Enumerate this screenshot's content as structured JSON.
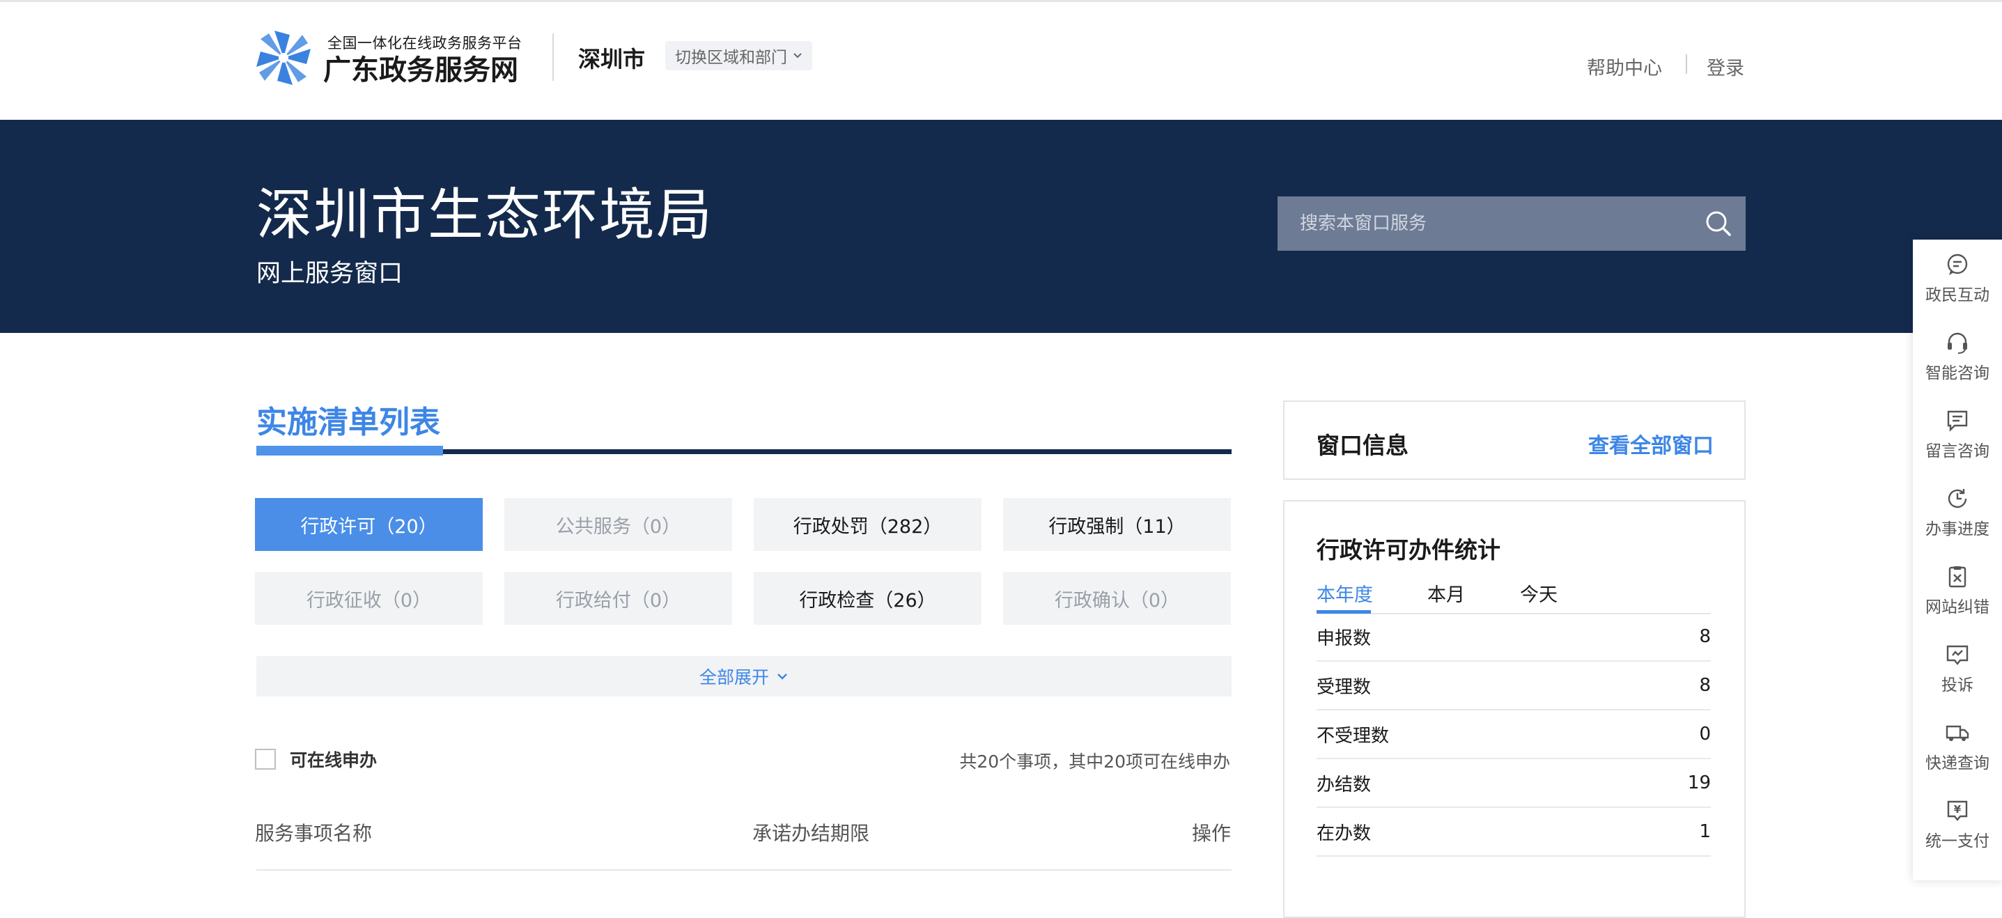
{
  "header": {
    "logo_top": "全国一体化在线政务服务平台",
    "logo_main": "广东政务服务网",
    "city": "深圳市",
    "region_switch": "切换区域和部门",
    "help": "帮助中心",
    "login": "登录"
  },
  "banner": {
    "title": "深圳市生态环境局",
    "subtitle": "网上服务窗口",
    "search_placeholder": "搜索本窗口服务"
  },
  "list": {
    "title": "实施清单列表",
    "categories": [
      {
        "label": "行政许可（20）",
        "state": "active"
      },
      {
        "label": "公共服务（0）",
        "state": "disabled"
      },
      {
        "label": "行政处罚（282）",
        "state": "normal"
      },
      {
        "label": "行政强制（11）",
        "state": "normal"
      },
      {
        "label": "行政征收（0）",
        "state": "disabled"
      },
      {
        "label": "行政给付（0）",
        "state": "disabled"
      },
      {
        "label": "行政检查（26）",
        "state": "normal"
      },
      {
        "label": "行政确认（0）",
        "state": "disabled"
      }
    ],
    "expand_all": "全部展开",
    "online_checkbox": "可在线申办",
    "summary": "共20个事项，其中20项可在线申办",
    "columns": [
      "服务事项名称",
      "承诺办结期限",
      "操作"
    ]
  },
  "window_info": {
    "title": "窗口信息",
    "link": "查看全部窗口"
  },
  "stats": {
    "title": "行政许可办件统计",
    "tabs": [
      "本年度",
      "本月",
      "今天"
    ],
    "active_tab": "本年度",
    "rows": [
      {
        "label": "申报数",
        "value": "8"
      },
      {
        "label": "受理数",
        "value": "8"
      },
      {
        "label": "不受理数",
        "value": "0"
      },
      {
        "label": "办结数",
        "value": "19"
      },
      {
        "label": "在办数",
        "value": "1"
      }
    ]
  },
  "sidebar": {
    "items": [
      {
        "label": "政民互动",
        "icon": "chat-icon"
      },
      {
        "label": "智能咨询",
        "icon": "headset-icon"
      },
      {
        "label": "留言咨询",
        "icon": "message-icon"
      },
      {
        "label": "办事进度",
        "icon": "clock-icon"
      },
      {
        "label": "网站纠错",
        "icon": "error-report-icon"
      },
      {
        "label": "投诉",
        "icon": "complaint-icon"
      },
      {
        "label": "快递查询",
        "icon": "truck-icon"
      },
      {
        "label": "统一支付",
        "icon": "payment-icon"
      }
    ]
  },
  "colors": {
    "banner_bg": "#142a4c",
    "accent": "#3d86e6",
    "active_tab_bg": "#4a8ee8"
  }
}
